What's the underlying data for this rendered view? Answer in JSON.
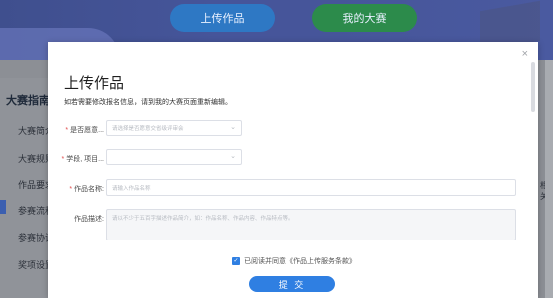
{
  "header": {
    "tabs": [
      {
        "label": "上传作品"
      },
      {
        "label": "我的大赛"
      }
    ]
  },
  "sidebar": {
    "title": "大赛指南",
    "items": [
      {
        "label": "大赛简介"
      },
      {
        "label": "大赛规则"
      },
      {
        "label": "作品要求"
      },
      {
        "label": "参赛流程"
      },
      {
        "label": "参赛协议"
      },
      {
        "label": "奖项设置"
      }
    ]
  },
  "background_right_text": "相关",
  "dialog": {
    "close_icon": "×",
    "title": "上传作品",
    "notice": "如若需要修改报名信息，请到我的大赛页面重新编辑。",
    "fields": {
      "committee": {
        "label": "是否愿意...",
        "placeholder": "请选择是否愿意交省级评审会"
      },
      "stage": {
        "label": "学段, 项目...",
        "placeholder": ""
      },
      "name": {
        "label": "作品名称:",
        "placeholder": "请输入作品名称"
      },
      "desc": {
        "label": "作品描述:",
        "placeholder": "请以不少于五百字描述作品简介，如：作品名称、作品内容、作品特点等。"
      }
    },
    "agree_text": "已阅读并同意《作品上传服务条款》",
    "submit_label": "提 交"
  }
}
